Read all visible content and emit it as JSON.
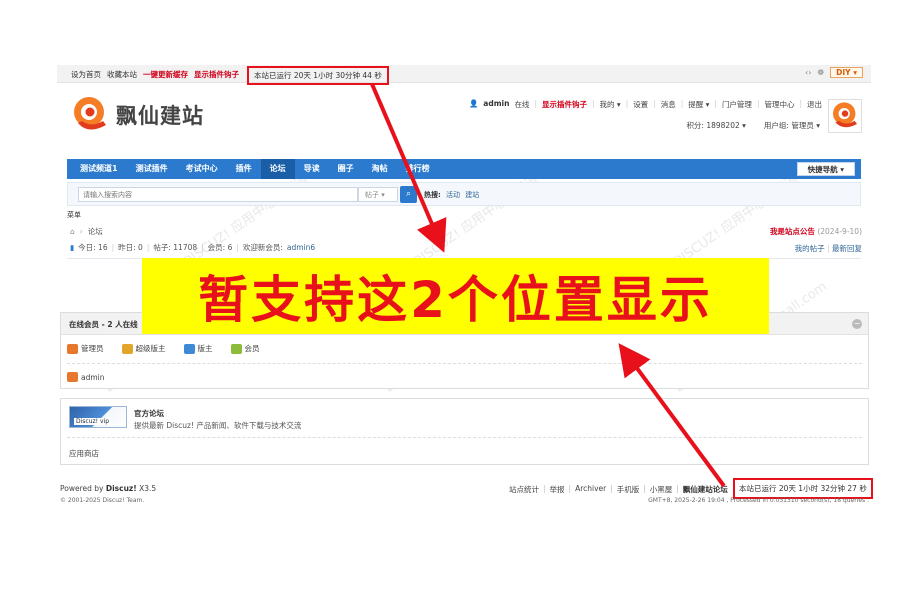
{
  "topbar": {
    "set_home": "设为首页",
    "bookmark": "收藏本站",
    "refresh_cache": "一键更新缓存",
    "show_hooks": "显示插件钩子",
    "uptime": "本站已运行 20天 1小时 30分钟 44 秒",
    "diy": "DIY",
    "icons": [
      "code-icon",
      "palette-icon"
    ]
  },
  "header": {
    "site_name": "飘仙建站",
    "user": "admin",
    "online": "在线",
    "hooks": "显示插件钩子",
    "my": "我的",
    "settings": "设置",
    "messages": "消息",
    "reminders": "提醒",
    "portal_admin": "门户管理",
    "admin_center": "管理中心",
    "logout": "退出",
    "points": "积分: 1898202",
    "group": "用户组: 管理员"
  },
  "nav": {
    "items": [
      "测试频道1",
      "测试插件",
      "考试中心",
      "插件",
      "论坛",
      "导读",
      "圈子",
      "淘帖",
      "排行榜"
    ],
    "active_index": 4,
    "quick_nav": "快捷导航"
  },
  "search": {
    "placeholder": "请输入搜索内容",
    "type": "帖子",
    "hot_label": "热搜:",
    "hot_terms": [
      "活动",
      "建站"
    ]
  },
  "menu_label": "菜单",
  "breadcrumb": {
    "current": "论坛"
  },
  "announcement": {
    "title": "我是站点公告",
    "date": "(2024-9-10)"
  },
  "stats": {
    "today": "今日: 16",
    "yesterday": "昨日: 0",
    "posts": "帖子: 11708",
    "members": "会员: 6",
    "welcome": "欢迎新会员:",
    "new_member": "admin6",
    "my_posts": "我的帖子",
    "latest_reply": "最新回复"
  },
  "banner": {
    "text": "暂支持这2个位置显示"
  },
  "online": {
    "title": "在线会员 - 2 人在线",
    "roles": [
      {
        "label": "管理员",
        "color": "#e8772e"
      },
      {
        "label": "超级版主",
        "color": "#e3a52a"
      },
      {
        "label": "版主",
        "color": "#3f8ad6"
      },
      {
        "label": "会员",
        "color": "#8dbb3a"
      }
    ],
    "member": "admin"
  },
  "links": {
    "logo_text": "Discuz! vip",
    "title": "官方论坛",
    "desc": "提供最新 Discuz! 产品新闻、软件下载与技术交流",
    "app_store": "应用商店"
  },
  "footer": {
    "powered_prefix": "Powered by",
    "powered_brand": "Discuz!",
    "version": "X3.5",
    "copyright": "© 2001-2025 Discuz! Team.",
    "links": [
      "站点统计",
      "举报",
      "Archiver",
      "手机版",
      "小黑屋"
    ],
    "site_forum": "飘仙建站论坛",
    "uptime": "本站已运行 20天 1小时 32分钟 27 秒",
    "processed": "GMT+8, 2025-2-26 19:04 , Processed in 0.031310 second(s), 18 queries ."
  },
  "colors": {
    "nav_blue": "#2b7acd",
    "highlight_red": "#e8111b",
    "banner_yellow": "#ffff00"
  }
}
